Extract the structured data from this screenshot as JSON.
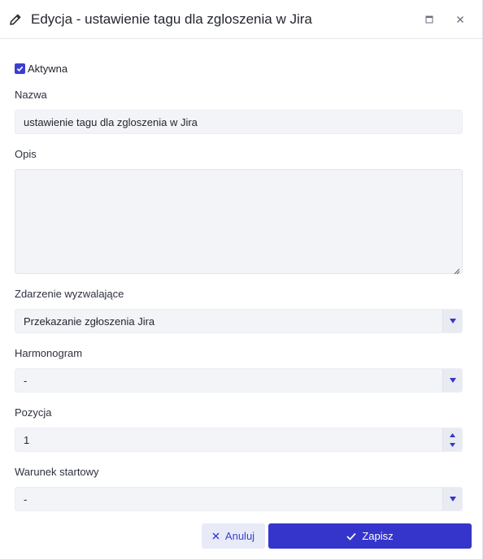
{
  "dialog": {
    "title": "Edycja - ustawienie tagu dla zgloszenia w Jira",
    "title_icon": "pencil-icon",
    "maximize_icon": "maximize-icon",
    "close_icon": "close-icon"
  },
  "form": {
    "active": {
      "label": "Aktywna",
      "checked": true
    },
    "name": {
      "label": "Nazwa",
      "value": "ustawienie tagu dla zgloszenia w Jira"
    },
    "description": {
      "label": "Opis",
      "value": ""
    },
    "trigger": {
      "label": "Zdarzenie wyzwalające",
      "value": "Przekazanie zgłoszenia Jira"
    },
    "schedule": {
      "label": "Harmonogram",
      "value": "-"
    },
    "position": {
      "label": "Pozycja",
      "value": "1"
    },
    "start_condition": {
      "label": "Warunek startowy",
      "value": "-"
    }
  },
  "footer": {
    "cancel_label": "Anuluj",
    "save_label": "Zapisz"
  },
  "colors": {
    "accent": "#3535cc",
    "field_bg": "#f3f4f8",
    "cancel_bg": "#e8ebf7"
  }
}
